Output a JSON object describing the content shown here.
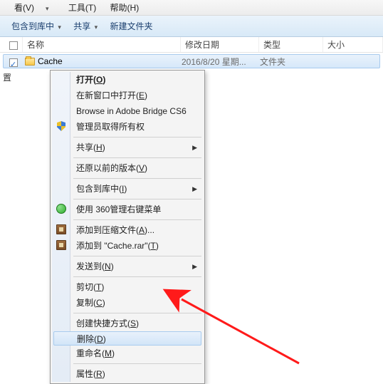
{
  "menubar": {
    "view": "看(V)",
    "tools": "工具(T)",
    "help": "帮助(H)"
  },
  "toolbar": {
    "include": "包含到库中",
    "share": "共享",
    "newfolder": "新建文件夹"
  },
  "columns": {
    "name": "名称",
    "date": "修改日期",
    "type": "类型",
    "size": "大小"
  },
  "row": {
    "name": "Cache",
    "date": "2016/8/20 星期...",
    "type": "文件夹",
    "size": ""
  },
  "leftstub": "置",
  "ctx": {
    "open": "打开",
    "open_key": "O",
    "open_new": "在新窗口中打开",
    "open_new_key": "E",
    "bridge": "Browse in Adobe Bridge CS6",
    "admin": "管理员取得所有权",
    "share": "共享",
    "share_key": "H",
    "restore": "还原以前的版本",
    "restore_key": "V",
    "tolib": "包含到库中",
    "tolib_key": "I",
    "use360": "使用 360管理右键菜单",
    "addrar": "添加到压缩文件",
    "addrar_key": "A",
    "addto": "添加到 \"Cache.rar\"",
    "addto_key": "T",
    "sendto": "发送到",
    "sendto_key": "N",
    "cut": "剪切",
    "cut_key": "T",
    "copy": "复制",
    "copy_key": "C",
    "shortcut": "创建快捷方式",
    "shortcut_key": "S",
    "delete": "删除",
    "delete_key": "D",
    "rename": "重命名",
    "rename_key": "M",
    "props": "属性",
    "props_key": "R"
  }
}
